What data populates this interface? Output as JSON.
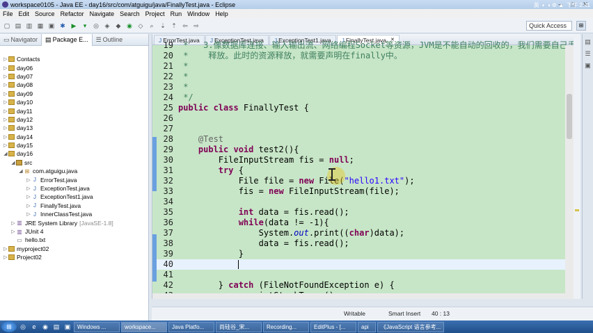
{
  "window": {
    "title": "workspace0105 - Java EE - day16/src/com/atguigu/java/FinallyTest.java - Eclipse"
  },
  "menu": [
    "File",
    "Edit",
    "Source",
    "Refactor",
    "Navigate",
    "Search",
    "Project",
    "Run",
    "Window",
    "Help"
  ],
  "toolbar": {
    "quick_access": "Quick Access"
  },
  "left_tabs": [
    {
      "label": "Navigator"
    },
    {
      "label": "Package E..."
    },
    {
      "label": "Outline"
    }
  ],
  "tree": [
    {
      "label": "Contacts",
      "indent": 0,
      "icon": "project-icon"
    },
    {
      "label": "day06",
      "indent": 0,
      "icon": "project-icon"
    },
    {
      "label": "day07",
      "indent": 0,
      "icon": "project-icon"
    },
    {
      "label": "day08",
      "indent": 0,
      "icon": "project-icon"
    },
    {
      "label": "day09",
      "indent": 0,
      "icon": "project-icon"
    },
    {
      "label": "day10",
      "indent": 0,
      "icon": "project-icon"
    },
    {
      "label": "day11",
      "indent": 0,
      "icon": "project-icon"
    },
    {
      "label": "day12",
      "indent": 0,
      "icon": "project-icon"
    },
    {
      "label": "day13",
      "indent": 0,
      "icon": "project-icon"
    },
    {
      "label": "day14",
      "indent": 0,
      "icon": "project-icon"
    },
    {
      "label": "day15",
      "indent": 0,
      "icon": "project-icon"
    },
    {
      "label": "day16",
      "indent": 0,
      "icon": "project-icon",
      "expanded": true
    },
    {
      "label": "src",
      "indent": 1,
      "icon": "source-folder-icon",
      "expanded": true
    },
    {
      "label": "com.atguigu.java",
      "indent": 2,
      "icon": "package-icon",
      "expanded": true
    },
    {
      "label": "ErrorTest.java",
      "indent": 3,
      "icon": "java-file-icon"
    },
    {
      "label": "ExceptionTest.java",
      "indent": 3,
      "icon": "java-file-icon"
    },
    {
      "label": "ExceptionTest1.java",
      "indent": 3,
      "icon": "java-file-icon"
    },
    {
      "label": "FinallyTest.java",
      "indent": 3,
      "icon": "java-file-icon"
    },
    {
      "label": "InnerClassTest.java",
      "indent": 3,
      "icon": "java-file-icon"
    },
    {
      "label": "JRE System Library",
      "suffix": "[JavaSE-1.8]",
      "indent": 1,
      "icon": "library-icon"
    },
    {
      "label": "JUnit 4",
      "indent": 1,
      "icon": "library-icon"
    },
    {
      "label": "hello.txt",
      "indent": 1,
      "icon": "text-file-icon"
    },
    {
      "label": "myproject02",
      "indent": 0,
      "icon": "project-icon"
    },
    {
      "label": "Project02",
      "indent": 0,
      "icon": "project-icon"
    }
  ],
  "editor_tabs": [
    {
      "label": "ErrorTest.java",
      "active": false
    },
    {
      "label": "ExceptionTest.java",
      "active": false
    },
    {
      "label": "ExceptionTest1.java",
      "active": false
    },
    {
      "label": "FinallyTest.java",
      "active": true
    }
  ],
  "code": [
    {
      "n": "19",
      "html": "<span class=\"cm\"> *   3.像数据库连接、输入输出流、网络编程Socket等资源，JVM是不能自动的回收的，我们需要自己手动的进行资源的</span>"
    },
    {
      "n": "20",
      "html": "<span class=\"cm\"> *    释放。此时的资源释放，就需要声明在finally中。</span>"
    },
    {
      "n": "21",
      "html": "<span class=\"cm\"> *</span>"
    },
    {
      "n": "22",
      "html": "<span class=\"cm\"> *</span>"
    },
    {
      "n": "23",
      "html": "<span class=\"cm\"> *</span>"
    },
    {
      "n": "24",
      "html": "<span class=\"cm\"> */</span>"
    },
    {
      "n": "25",
      "html": "<span class=\"kw\">public class</span> FinallyTest {"
    },
    {
      "n": "26",
      "html": ""
    },
    {
      "n": "27",
      "html": ""
    },
    {
      "n": "28",
      "html": "    <span class=\"an\">@Test</span>"
    },
    {
      "n": "29",
      "html": "    <span class=\"kw\">public void</span> test2(){"
    },
    {
      "n": "30",
      "html": "        FileInputStream fis = <span class=\"kw\">null</span>;"
    },
    {
      "n": "31",
      "html": "        <span class=\"kw\">try</span> {"
    },
    {
      "n": "32",
      "html": "            File file = <span class=\"kw\">new</span> File(<span class=\"str\">\"hello1.txt\"</span>);"
    },
    {
      "n": "33",
      "html": "            fis = <span class=\"kw\">new</span> FileInputStream(file);"
    },
    {
      "n": "34",
      "html": ""
    },
    {
      "n": "35",
      "html": "            <span class=\"kw\">int</span> data = fis.read();"
    },
    {
      "n": "36",
      "html": "            <span class=\"kw\">while</span>(data != -1){"
    },
    {
      "n": "37",
      "html": "                System.<span class=\"fld\">out</span>.print((<span class=\"kw\">char</span>)data);"
    },
    {
      "n": "38",
      "html": "                data = fis.read();"
    },
    {
      "n": "39",
      "html": "            }"
    },
    {
      "n": "40",
      "html": "            ",
      "current": true
    },
    {
      "n": "41",
      "html": ""
    },
    {
      "n": "42",
      "html": "        } <span class=\"kw\">catch</span> (FileNotFoundException e) {"
    },
    {
      "n": "43",
      "html": "            e.printStackTrace();"
    }
  ],
  "status": {
    "mode": "Writable",
    "insert": "Smart Insert",
    "position": "40 : 13"
  },
  "taskbar": [
    {
      "label": "Windows ..."
    },
    {
      "label": "workspace..."
    },
    {
      "label": "Java Platfo..."
    },
    {
      "label": "尚硅谷_宋..."
    },
    {
      "label": "Recording..."
    },
    {
      "label": "EditPlus - [..."
    },
    {
      "label": "api"
    },
    {
      "label": "《JavaScript 语言参考..."
    }
  ],
  "tray": {
    "ime": "英",
    "clock": "下午 2:41"
  }
}
